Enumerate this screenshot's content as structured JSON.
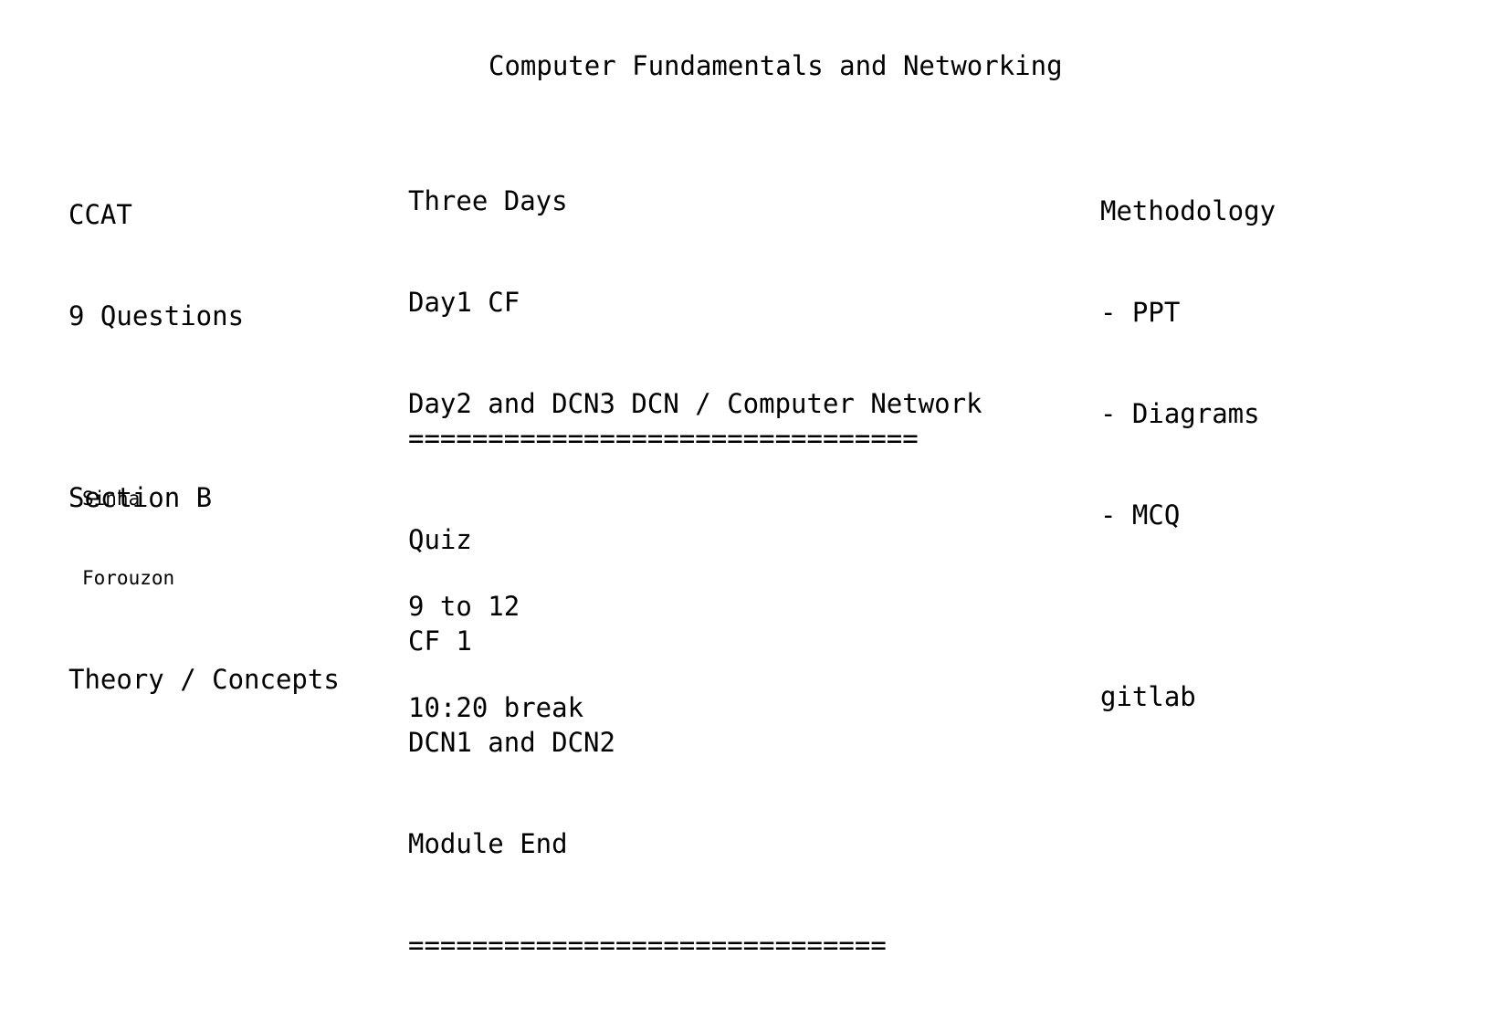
{
  "title": "Computer Fundamentals and Networking",
  "left": {
    "ccat": "CCAT",
    "questions": "9 Questions",
    "section": "Section B",
    "theory": "Theory / Concepts"
  },
  "books": {
    "author1": "Sinha",
    "author2": "Forouzon"
  },
  "schedule": {
    "days": "Three Days",
    "day1": "Day1 CF",
    "day2": "Day2 and DCN3 DCN / Computer Network",
    "hours": "9 to 12",
    "break": "10:20 break"
  },
  "quiz": {
    "rule_top": "================================",
    "label": "Quiz",
    "cf": "CF 1",
    "dcn": "DCN1 and DCN2",
    "module_end": "Module End",
    "rule_bottom": "=============================="
  },
  "methodology": {
    "heading": "Methodology",
    "items": [
      "- PPT",
      "- Diagrams",
      "- MCQ"
    ],
    "gitlab": "gitlab"
  }
}
